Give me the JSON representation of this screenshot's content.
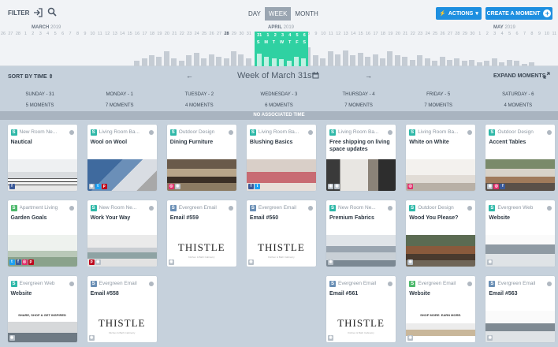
{
  "toolbar": {
    "filter_label": "FILTER",
    "range_options": [
      "DAY",
      "WEEK",
      "MONTH"
    ],
    "active_range": "WEEK",
    "actions_label": "ACTIONS",
    "create_label": "CREATE A MOMENT"
  },
  "timeline": {
    "months": [
      {
        "name": "MARCH",
        "year": "2019"
      },
      {
        "name": "APRIL",
        "year": "2019"
      },
      {
        "name": "MAY",
        "year": "2019"
      }
    ],
    "day_numbers": [
      "26",
      "27",
      "28",
      "1",
      "2",
      "3",
      "4",
      "5",
      "6",
      "7",
      "8",
      "9",
      "10",
      "11",
      "12",
      "13",
      "14",
      "15",
      "16",
      "17",
      "18",
      "19",
      "20",
      "21",
      "22",
      "23",
      "24",
      "25",
      "26",
      "27",
      "28",
      "29",
      "30",
      "31",
      "1",
      "2",
      "3",
      "4",
      "5",
      "6",
      "7",
      "8",
      "9",
      "10",
      "11",
      "12",
      "13",
      "14",
      "15",
      "16",
      "17",
      "18",
      "19",
      "20",
      "21",
      "22",
      "23",
      "24",
      "25",
      "26",
      "27",
      "28",
      "29",
      "30",
      "1",
      "2",
      "3",
      "4",
      "5",
      "6",
      "7",
      "8",
      "9",
      "10",
      "11"
    ],
    "current_day": "28",
    "selected_week_dates": [
      "31",
      "1",
      "2",
      "3",
      "4",
      "5",
      "6"
    ],
    "selected_week_letters": [
      "S",
      "M",
      "T",
      "W",
      "T",
      "F",
      "S"
    ],
    "bar_levels": [
      0,
      0,
      0,
      0,
      0,
      0,
      0,
      0,
      0,
      0,
      0,
      0,
      0,
      0,
      0,
      0,
      0,
      0,
      0.2,
      0.3,
      0.4,
      0.35,
      0.55,
      0.3,
      0.2,
      0.4,
      0.5,
      0.3,
      0.45,
      0.35,
      0.3,
      0.55,
      0.45,
      0.3,
      0.8,
      0.6,
      0.5,
      0.45,
      0.35,
      0.6,
      0.5,
      0.7,
      0.4,
      0.3,
      0.55,
      0.45,
      0.6,
      0.4,
      0.5,
      0.35,
      0.45,
      0.3,
      0.55,
      0.4,
      0.35,
      0.25,
      0.4,
      0.3,
      0.2,
      0.35,
      0.25,
      0.3,
      0.2,
      0.25,
      0.15,
      0.2,
      0.3,
      0.15,
      0.25,
      0.2,
      0.1,
      0.15
    ]
  },
  "week": {
    "sort_label": "SORT BY TIME",
    "title": "Week of March 31st",
    "expand_label": "EXPAND MOMENTS",
    "no_associated_time": "NO ASSOCIATED TIME",
    "days": [
      {
        "name": "SUNDAY - 31",
        "moments": "5 MOMENTS"
      },
      {
        "name": "MONDAY - 1",
        "moments": "7 MOMENTS"
      },
      {
        "name": "TUESDAY - 2",
        "moments": "4 MOMENTS"
      },
      {
        "name": "WEDNESDAY - 3",
        "moments": "6 MOMENTS"
      },
      {
        "name": "THURSDAY - 4",
        "moments": "7 MOMENTS"
      },
      {
        "name": "FRIDAY - 5",
        "moments": "7 MOMENTS"
      },
      {
        "name": "SATURDAY - 6",
        "moments": "4 MOMENTS"
      }
    ]
  },
  "colors": {
    "teal": "#2fb8a8",
    "blue": "#6a8fb5",
    "green": "#4cb86b",
    "accent": "#1e8fe0"
  },
  "cards": [
    [
      {
        "group": "New Room Ne...",
        "badge": "teal",
        "title": "Nautical",
        "img": "nautical",
        "nets": [
          "fb"
        ]
      },
      {
        "group": "Apartment Living",
        "badge": "green",
        "title": "Garden Goals",
        "img": "garden",
        "nets": [
          "tw",
          "fb",
          "ig",
          "pi"
        ]
      },
      {
        "group": "Evergreen Web",
        "badge": "teal",
        "title": "Website",
        "img": "web1",
        "nets": [
          "gr"
        ]
      }
    ],
    [
      {
        "group": "Living Room Ba...",
        "badge": "teal",
        "title": "Wool on Wool",
        "img": "wool",
        "nets": [
          "gr",
          "tw",
          "pi"
        ]
      },
      {
        "group": "New Room Ne...",
        "badge": "teal",
        "title": "Work Your Way",
        "img": "work",
        "nets": [
          "pi",
          "gr"
        ]
      },
      {
        "group": "Evergreen Email",
        "badge": "blue",
        "title": "Email #558",
        "img": "thistle",
        "nets": [
          "gr"
        ]
      }
    ],
    [
      {
        "group": "Outdoor Design",
        "badge": "teal",
        "title": "Dining Furniture",
        "img": "dining",
        "nets": [
          "ig",
          "gr"
        ]
      },
      {
        "group": "Evergreen Email",
        "badge": "blue",
        "title": "Email #559",
        "img": "thistle",
        "nets": [
          "gr"
        ]
      }
    ],
    [
      {
        "group": "Living Room Ba...",
        "badge": "teal",
        "title": "Blushing Basics",
        "img": "blush",
        "nets": [
          "fb",
          "tw"
        ]
      },
      {
        "group": "Evergreen Email",
        "badge": "blue",
        "title": "Email #560",
        "img": "thistle",
        "nets": [
          "gr"
        ]
      }
    ],
    [
      {
        "group": "Living Room Ba...",
        "badge": "teal",
        "title": "Free shipping on living space updates",
        "img": "shipping",
        "nets": [
          "gr",
          "gr"
        ]
      },
      {
        "group": "New Room Ne...",
        "badge": "teal",
        "title": "Premium Fabrics",
        "img": "fabric",
        "nets": [
          "gr"
        ]
      },
      {
        "group": "Evergreen Email",
        "badge": "blue",
        "title": "Email #561",
        "img": "thistle",
        "nets": [
          "gr"
        ]
      }
    ],
    [
      {
        "group": "Living Room Ba...",
        "badge": "teal",
        "title": "White on White",
        "img": "white",
        "nets": [
          "ig"
        ]
      },
      {
        "group": "Outdoor Design",
        "badge": "teal",
        "title": "Wood You Please?",
        "img": "wood",
        "nets": [
          "gr"
        ]
      },
      {
        "group": "Evergreen Email",
        "badge": "green",
        "title": "Website",
        "img": "shopmore",
        "nets": [
          "gr"
        ]
      }
    ],
    [
      {
        "group": "Outdoor Design",
        "badge": "teal",
        "title": "Accent Tables",
        "img": "accent",
        "nets": [
          "gr",
          "ig",
          "fb"
        ]
      },
      {
        "group": "Evergreen Web",
        "badge": "teal",
        "title": "Website",
        "img": "web2",
        "nets": [
          "gr"
        ]
      },
      {
        "group": "Evergreen Email",
        "badge": "blue",
        "title": "Email #563",
        "img": "email563",
        "nets": [
          "gr"
        ]
      }
    ]
  ],
  "thistle": {
    "word": "THISTLE",
    "tagline": "Kitchen & Bath Cabinetry"
  },
  "web1_headline": "SHARE, SHOP & GET INSPIRED",
  "shopmore_headline": "SHOP MORE. EARN MORE."
}
